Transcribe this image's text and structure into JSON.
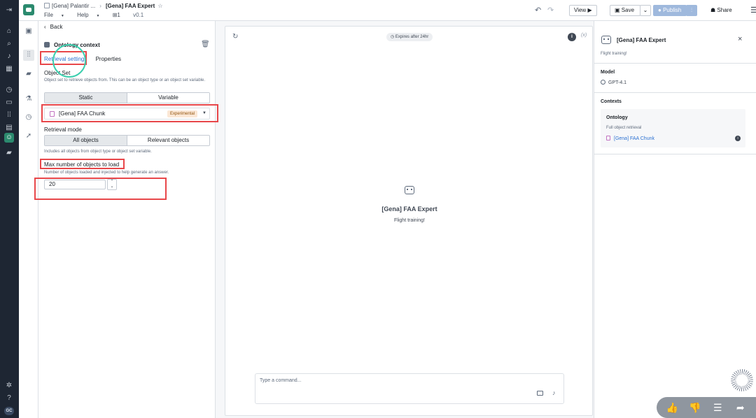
{
  "header": {
    "breadcrumb_parent": "[Gena] Palantir ...",
    "breadcrumb_current": "[Gena] FAA Expert",
    "menu_file": "File",
    "menu_help": "Help",
    "count": "1",
    "version": "v0.1",
    "view_label": "View",
    "save_label": "Save",
    "publish_label": "Publish",
    "share_label": "Share"
  },
  "left_panel": {
    "back_label": "Back",
    "section_title": "Ontology context",
    "tabs": [
      "Retrieval settings",
      "Properties"
    ],
    "object_set_label": "Object Set",
    "object_set_help": "Object set to retrieve objects from. This can be an object type or an object set variable.",
    "object_set_modes": [
      "Static",
      "Variable"
    ],
    "object_set_value": "[Gena] FAA Chunk",
    "object_set_tag": "Experimental",
    "retrieval_mode_label": "Retrieval mode",
    "retrieval_modes": [
      "All objects",
      "Relevant objects"
    ],
    "retrieval_mode_help": "Includes all objects from object type or object set variable.",
    "max_objects_label": "Max number of objects to load",
    "max_objects_help": "Number of objects loaded and injected to help generate an answer.",
    "max_objects_value": "20"
  },
  "center": {
    "expires": "Expires after 24hr",
    "fx_label": "(x)",
    "agent_title": "[Gena] FAA Expert",
    "agent_subtitle": "Flight training!",
    "command_placeholder": "Type a command..."
  },
  "right_panel": {
    "title": "[Gena] FAA Expert",
    "subtitle": "Flight training!",
    "model_label": "Model",
    "model_value": "GPT-4.1",
    "contexts_label": "Contexts",
    "context_title": "Ontology",
    "context_desc": "Full object retrieval",
    "context_link": "[Gena] FAA Chunk"
  },
  "user_initials": "GC",
  "colors": {
    "accent": "#2b8a6e",
    "link": "#2d72d2",
    "highlight": "#e8474a",
    "click_ring": "#3ccfae",
    "rail": "#1e2633"
  }
}
